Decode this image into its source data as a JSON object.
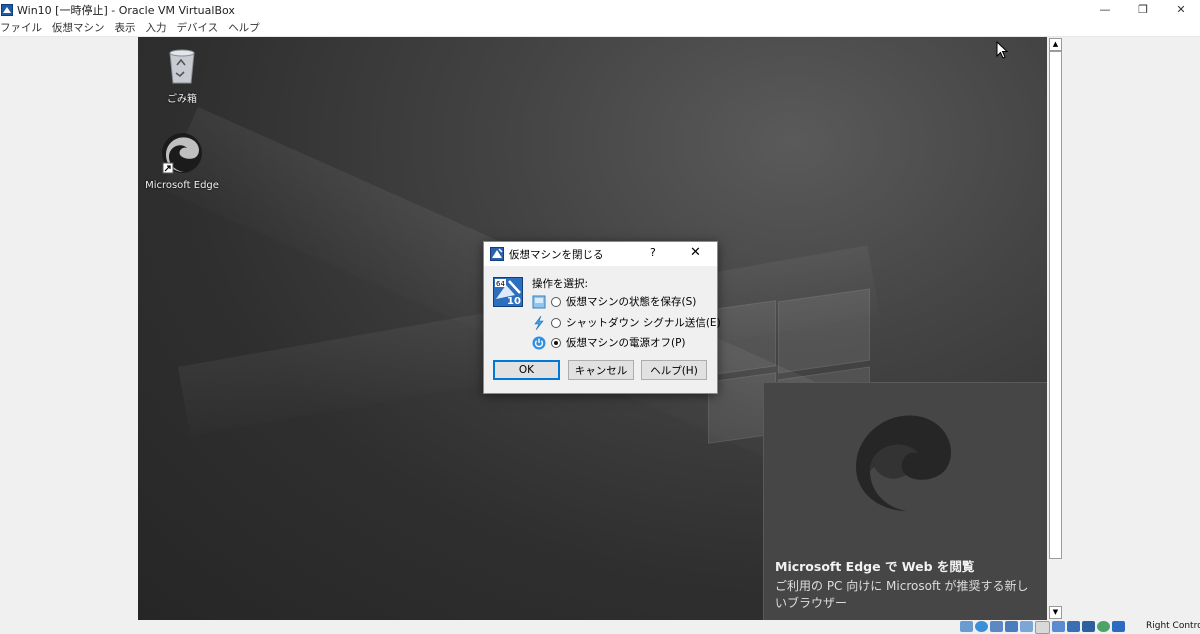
{
  "window": {
    "title": "Win10 [一時停止] - Oracle VM VirtualBox",
    "minimize_glyph": "—",
    "maximize_glyph": "❐",
    "close_glyph": "✕"
  },
  "menu": [
    "ファイル",
    "仮想マシン",
    "表示",
    "入力",
    "デバイス",
    "ヘルプ"
  ],
  "desktop": {
    "icons": [
      {
        "label": "ごみ箱",
        "icon": "recycle-bin-icon"
      },
      {
        "label": "Microsoft Edge",
        "icon": "edge-icon"
      }
    ]
  },
  "toast": {
    "title": "Microsoft Edge で Web を閲覧",
    "body": "ご利用の PC 向けに Microsoft が推奨する新しいブラウザー"
  },
  "dialog": {
    "title": "仮想マシンを閉じる",
    "help_glyph": "?",
    "close_glyph": "✕",
    "prompt": "操作を選択:",
    "options": [
      {
        "label": "仮想マシンの状態を保存(S)",
        "icon": "save-state-icon",
        "checked": false
      },
      {
        "label": "シャットダウン シグナル送信(E)",
        "icon": "lightning-icon",
        "checked": false
      },
      {
        "label": "仮想マシンの電源オフ(P)",
        "icon": "power-icon",
        "checked": true
      }
    ],
    "buttons": {
      "ok": "OK",
      "cancel": "キャンセル",
      "help": "ヘルプ(H)"
    }
  },
  "scrollbar": {
    "up": "▲",
    "down": "▼"
  },
  "statusbar": {
    "host_key": "Right Control",
    "icons": [
      "hard-disk-icon",
      "optical-drive-icon",
      "audio-icon",
      "network-icon",
      "usb-icon",
      "shared-folder-icon",
      "display-icon",
      "recording-icon",
      "cpu-icon",
      "mouse-integration-icon",
      "host-key-icon"
    ]
  },
  "colors": {
    "accent": "#0078d7",
    "toast_bg": "#464646",
    "desktop_dark": "#2f2f2f"
  }
}
